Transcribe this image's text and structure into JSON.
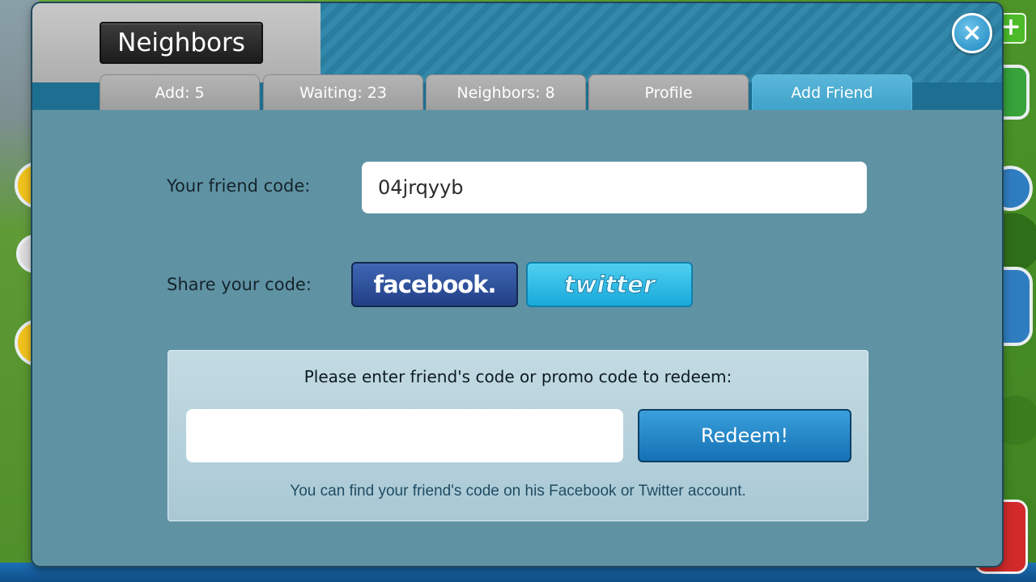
{
  "dialog": {
    "title": "Neighbors",
    "close_icon": "×",
    "tabs": [
      {
        "label": "Add: 5",
        "active": false
      },
      {
        "label": "Waiting: 23",
        "active": false
      },
      {
        "label": "Neighbors: 8",
        "active": false
      },
      {
        "label": "Profile",
        "active": false
      },
      {
        "label": "Add Friend",
        "active": true
      }
    ]
  },
  "friend_code": {
    "label": "Your friend code:",
    "value": "04jrqyyb"
  },
  "share": {
    "label": "Share your code:",
    "facebook_label": "facebook.",
    "twitter_label": "twitter"
  },
  "redeem": {
    "prompt": "Please enter friend's code or promo code to redeem:",
    "input_value": "",
    "input_placeholder": "",
    "button_label": "Redeem!",
    "hint": "You can find your friend's code on his Facebook or Twitter account."
  },
  "background": {
    "plus_icon": "+"
  },
  "colors": {
    "active_tab": "#4aaed3",
    "inactive_tab": "#a8a8a8",
    "facebook": "#2d4f9c",
    "twitter": "#2bbbe6",
    "redeem_button": "#1f83c6"
  }
}
